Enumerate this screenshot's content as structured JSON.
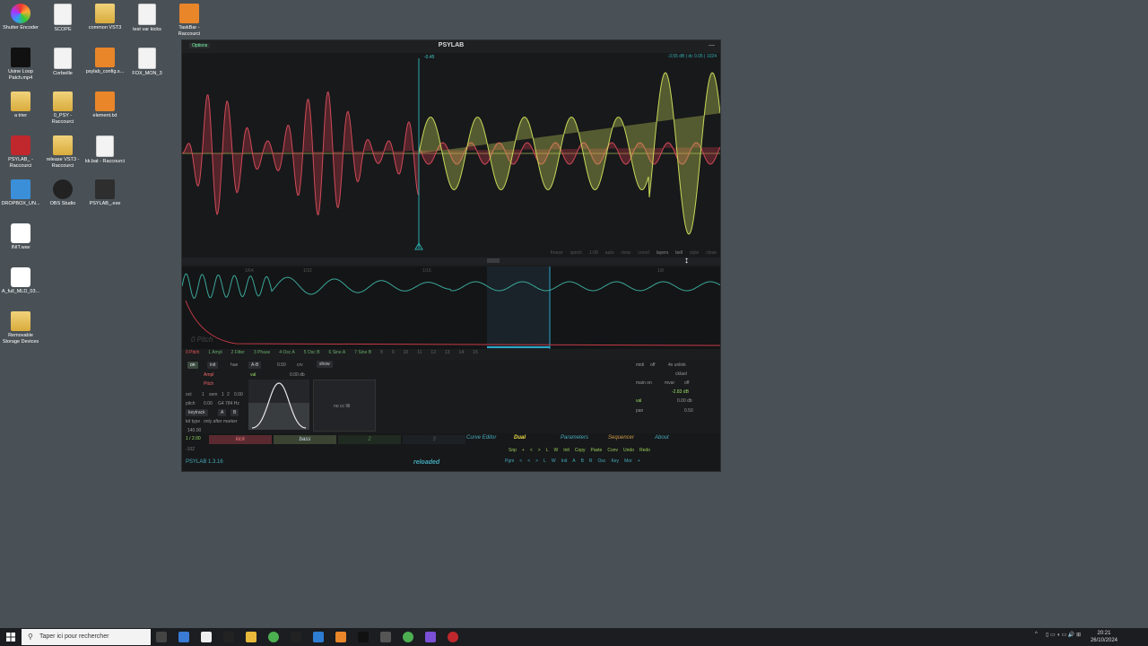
{
  "desktop": {
    "icons": [
      {
        "label": "Shutter Encoder",
        "kind": "color"
      },
      {
        "label": "SCOPE",
        "kind": "file"
      },
      {
        "label": "common VST3",
        "kind": "folder"
      },
      {
        "label": "test var kicks",
        "kind": "file"
      },
      {
        "label": "TaskBar - Raccourci",
        "kind": "orange"
      },
      {
        "label": "Usine Loop Patch.mp4",
        "kind": "dark"
      },
      {
        "label": "Corbeille",
        "kind": "file"
      },
      {
        "label": "psylab_config.s...",
        "kind": "orange"
      },
      {
        "label": "FOX_MON_3",
        "kind": "file"
      },
      {
        "label": "a trier",
        "kind": "folder"
      },
      {
        "label": "0_PSY - Raccourci",
        "kind": "folder"
      },
      {
        "label": "element.txt",
        "kind": "orange"
      },
      {
        "label": "PSYLAB_ - Raccourci",
        "kind": "red"
      },
      {
        "label": "release VST3 - Raccourci",
        "kind": "folder"
      },
      {
        "label": "kk.bat - Raccourci",
        "kind": "file"
      },
      {
        "label": "DROPBOX_UN...",
        "kind": "blue"
      },
      {
        "label": "OBS Studio",
        "kind": "ring"
      },
      {
        "label": "PSYLAB_.exe",
        "kind": "sub"
      },
      {
        "label": "INIT.wav",
        "kind": "wav"
      },
      {
        "label": "A_full_MLD_03...",
        "kind": "wav"
      },
      {
        "label": "Removable Storage Devices",
        "kind": "folder"
      }
    ]
  },
  "window": {
    "title": "PSYLAB",
    "options_label": "Options",
    "minimize": "—",
    "wave_readout": "-3.55 dB | dc 0.05 | 1024",
    "cursor_value": "-0.45",
    "wave_toolbar": [
      "freeze",
      "spech",
      "1:08",
      "auto",
      "clear",
      "correl",
      "layers",
      "bell",
      "style",
      "close"
    ],
    "env_ticks": [
      "1/64",
      "1/32",
      "1/16",
      "1/8"
    ],
    "pitch_label": "0 Pitch",
    "tabs": [
      "0 Pitch",
      "1 Ampl",
      "2 Filter",
      "3 Phase",
      "4 Osc A",
      "5 Osc B",
      "6 Sine A",
      "7 Sine B",
      "8",
      "9",
      "10",
      "11",
      "12",
      "13",
      "14",
      "15"
    ],
    "controls": {
      "on": "on",
      "init": "init",
      "hue": "hue",
      "ab": "A-B",
      "v050": "0.50",
      "crv": "crv",
      "show": "show",
      "ampl": "Ampl",
      "pitch": "Pitch",
      "oct": "oct",
      "oct_val": "1",
      "sem": "sem",
      "sem_val": "1",
      "cents": "2",
      "cents_val": "0.00",
      "pitch_lbl": "pitch",
      "pitch_val": "0.00",
      "note": "G4 784 Hz",
      "keytrack": "keytrack",
      "a": "A",
      "b": "B",
      "kd_type": "kd type",
      "kd_val": "only after marker",
      "val": "val",
      "val_db": "0.00 db",
      "box2": "no cc fill",
      "midi": "midi",
      "midi_val": "off",
      "unlink": "4x unlink",
      "ckloal": "cklaol",
      "main_on": "main on",
      "mvar": "mvar",
      "mvar_val": "off",
      "gain": "-2.83 dB",
      "right_val": "val",
      "right_db": "0.00 db",
      "pan": "pan",
      "pan_val": "0.50",
      "bpm": "140.00",
      "bar": "1 / 2.00",
      "m102": "-102"
    },
    "tracks": [
      {
        "label": "kick",
        "color": "#c84a55"
      },
      {
        "label": "bass",
        "color": "#8a9a5a"
      },
      {
        "label": "2",
        "color": "#2a3a2a"
      },
      {
        "label": "3",
        "color": "#262a2e"
      }
    ],
    "nav": {
      "curve": "Curve Editor",
      "dual": "Dual",
      "params": "Parameters",
      "seq": "Sequencer",
      "about": "About"
    },
    "row1": [
      "Snp",
      "+",
      "<",
      ">",
      "L",
      "W",
      "Init",
      "Copy",
      "Paste",
      "Conv",
      "Undo",
      "Redo"
    ],
    "row2": [
      "Pgm",
      "<",
      "<",
      ">",
      "L",
      "W",
      "Init",
      "A",
      "B",
      "R",
      "Osc",
      "Key",
      "Mor",
      "+"
    ],
    "version": "PSYLAB 1.3.16",
    "status": "reloaded"
  },
  "taskbar": {
    "search_placeholder": "Taper ici pour rechercher",
    "time": "20:21",
    "date": "26/10/2024"
  },
  "colors": {
    "desktop": "#4a5156",
    "wave_red": "#c43a48",
    "wave_yellow": "#c8d85a",
    "accent_teal": "#3bb"
  }
}
